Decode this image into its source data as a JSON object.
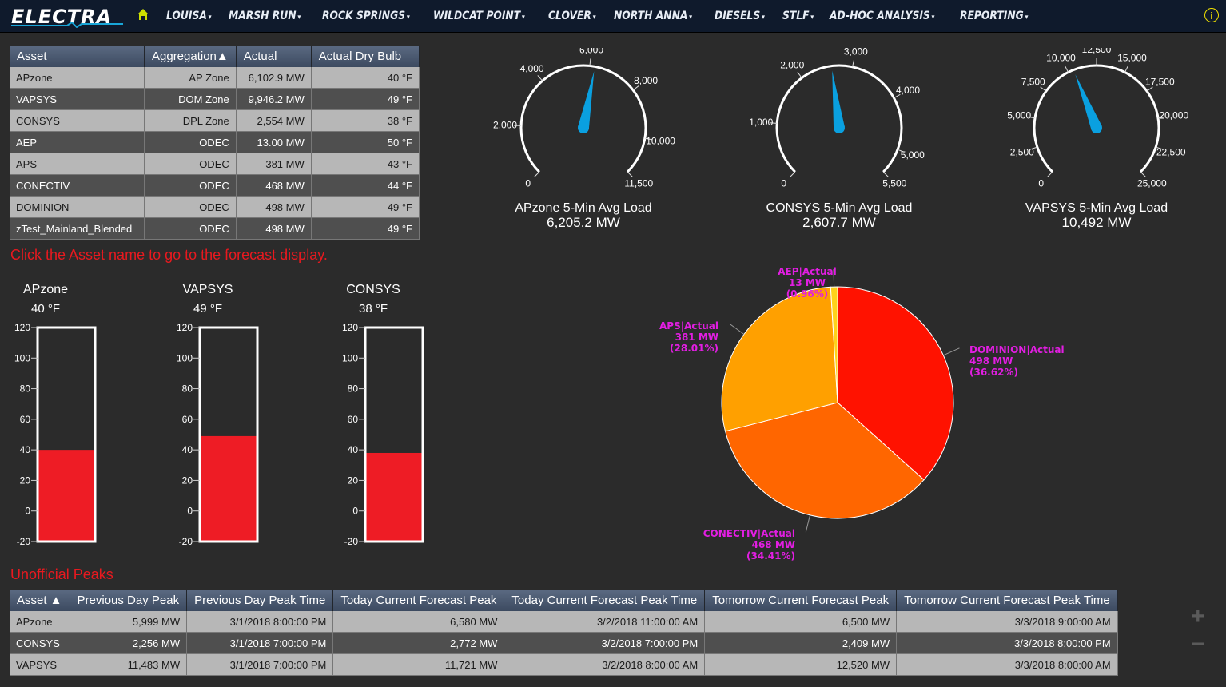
{
  "nav": {
    "logo": "ELECTRA",
    "items": [
      "LOUISA",
      "MARSH RUN",
      "ROCK SPRINGS",
      "WILDCAT POINT",
      "CLOVER",
      "NORTH ANNA",
      "DIESELS",
      "STLF",
      "AD-HOC ANALYSIS",
      "REPORTING"
    ],
    "info": "i"
  },
  "asset_table": {
    "headers": [
      "Asset",
      "Aggregation▲",
      "Actual",
      "Actual Dry Bulb"
    ],
    "rows": [
      [
        "APzone",
        "AP Zone",
        "6,102.9 MW",
        "40 °F"
      ],
      [
        "VAPSYS",
        "DOM Zone",
        "9,946.2 MW",
        "49 °F"
      ],
      [
        "CONSYS",
        "DPL Zone",
        "2,554 MW",
        "38 °F"
      ],
      [
        "AEP",
        "ODEC",
        "13.00 MW",
        "50 °F"
      ],
      [
        "APS",
        "ODEC",
        "381 MW",
        "43 °F"
      ],
      [
        "CONECTIV",
        "ODEC",
        "468 MW",
        "44 °F"
      ],
      [
        "DOMINION",
        "ODEC",
        "498 MW",
        "49 °F"
      ],
      [
        "zTest_Mainland_Blended",
        "ODEC",
        "498 MW",
        "49 °F"
      ]
    ]
  },
  "hint": "Click the Asset name to go to the forecast display.",
  "thermometers": [
    {
      "name": "APzone",
      "value": "40",
      "unit": "°F",
      "level": 40
    },
    {
      "name": "VAPSYS",
      "value": "49",
      "unit": "°F",
      "level": 49
    },
    {
      "name": "CONSYS",
      "value": "38",
      "unit": "°F",
      "level": 38
    }
  ],
  "thermo_scale": {
    "min": -20,
    "max": 120,
    "ticks": [
      "120",
      "100",
      "80",
      "60",
      "40",
      "20",
      "0",
      "-20"
    ]
  },
  "gauges": [
    {
      "title": "APzone 5-Min Avg Load",
      "value_label": "6,205.2 MW",
      "value": 6205.2,
      "max": 11500,
      "ticks": [
        [
          0,
          "0"
        ],
        [
          2000,
          "2,000"
        ],
        [
          4000,
          "4,000"
        ],
        [
          6000,
          "6,000"
        ],
        [
          8000,
          "8,000"
        ],
        [
          10000,
          "10,000"
        ],
        [
          11500,
          "11,500"
        ]
      ]
    },
    {
      "title": "CONSYS 5-Min Avg Load",
      "value_label": "2,607.7 MW",
      "value": 2607.7,
      "max": 5500,
      "ticks": [
        [
          0,
          "0"
        ],
        [
          1000,
          "1,000"
        ],
        [
          2000,
          "2,000"
        ],
        [
          3000,
          "3,000"
        ],
        [
          4000,
          "4,000"
        ],
        [
          5000,
          "5,000"
        ],
        [
          5500,
          "5,500"
        ]
      ]
    },
    {
      "title": "VAPSYS 5-Min Avg Load",
      "value_label": "10,492 MW",
      "value": 10492,
      "max": 25000,
      "ticks": [
        [
          0,
          "0"
        ],
        [
          2500,
          "2,500"
        ],
        [
          5000,
          "5,000"
        ],
        [
          7500,
          "7,500"
        ],
        [
          10000,
          "10,000"
        ],
        [
          12500,
          "12,500"
        ],
        [
          15000,
          "15,000"
        ],
        [
          17500,
          "17,500"
        ],
        [
          20000,
          "20,000"
        ],
        [
          22500,
          "22,500"
        ],
        [
          25000,
          "25,000"
        ]
      ]
    }
  ],
  "chart_data": {
    "type": "pie",
    "slices": [
      {
        "name": "DOMINION|Actual",
        "value": 498,
        "value_label": "498 MW",
        "percent": "(36.62%)",
        "color": "#ff1200"
      },
      {
        "name": "CONECTIV|Actual",
        "value": 468,
        "value_label": "468 MW",
        "percent": "(34.41%)",
        "color": "#ff6600"
      },
      {
        "name": "APS|Actual",
        "value": 381,
        "value_label": "381 MW",
        "percent": "(28.01%)",
        "color": "#ffa000"
      },
      {
        "name": "AEP|Actual",
        "value": 13,
        "value_label": "13 MW",
        "percent": "(0.96%)",
        "color": "#ffd21a"
      }
    ],
    "label_color": "#e21ee2"
  },
  "peaks": {
    "title": "Unofficial Peaks",
    "headers": [
      "Asset ▲",
      "Previous Day Peak",
      "Previous Day Peak Time",
      "Today Current Forecast Peak",
      "Today Current Forecast Peak Time",
      "Tomorrow Current Forecast Peak",
      "Tomorrow Current Forecast Peak Time"
    ],
    "rows": [
      [
        "APzone",
        "5,999 MW",
        "3/1/2018 8:00:00 PM",
        "6,580 MW",
        "3/2/2018 11:00:00 AM",
        "6,500 MW",
        "3/3/2018 9:00:00 AM"
      ],
      [
        "CONSYS",
        "2,256 MW",
        "3/1/2018 7:00:00 PM",
        "2,772 MW",
        "3/2/2018 7:00:00 PM",
        "2,409 MW",
        "3/3/2018 8:00:00 PM"
      ],
      [
        "VAPSYS",
        "11,483 MW",
        "3/1/2018 7:00:00 PM",
        "11,721 MW",
        "3/2/2018 8:00:00 AM",
        "12,520 MW",
        "3/3/2018 8:00:00 AM"
      ]
    ]
  },
  "colors": {
    "accent_red": "#e8191f",
    "gauge_needle": "#0aa0e0",
    "thermo_fill": "#ee1c25"
  }
}
